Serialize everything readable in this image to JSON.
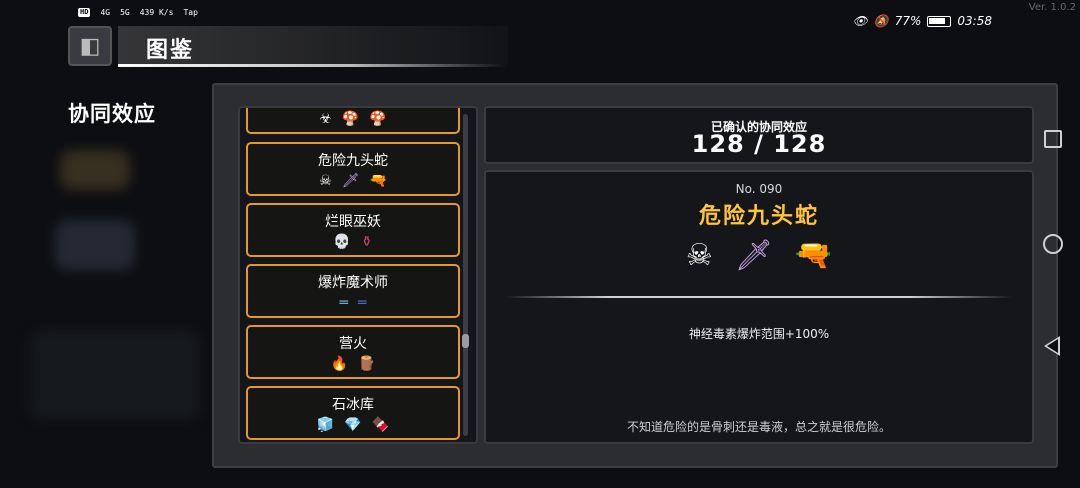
{
  "status_bar": {
    "left": [
      "HD",
      "4G",
      "5G",
      "439 K/s",
      "Tap"
    ],
    "eye_icon": "eye-icon",
    "bell_icon": "bell-muted-icon",
    "battery_percent": "77%",
    "time": "03:58"
  },
  "version": "Ver. 1.0.2",
  "header": {
    "title": "图鉴",
    "back_icon": "back-icon"
  },
  "section_title": "协同效应",
  "list": {
    "items": [
      {
        "label": "",
        "icons": [
          "☣",
          "🍄",
          "🍄"
        ],
        "colors": [
          "#ffffff",
          "#7fb6e8",
          "#d05040"
        ]
      },
      {
        "label": "危险九头蛇",
        "icons": [
          "☠",
          "🗡",
          "🔫"
        ],
        "colors": [
          "#ffffff",
          "#c8a0e0",
          "#c06040"
        ]
      },
      {
        "label": "烂眼巫妖",
        "icons": [
          "💀",
          "⚱"
        ],
        "colors": [
          "#e8e0c8",
          "#d04060"
        ]
      },
      {
        "label": "爆炸魔术师",
        "icons": [
          "═",
          "═"
        ],
        "colors": [
          "#6ab0c8",
          "#4070c0"
        ]
      },
      {
        "label": "营火",
        "icons": [
          "🔥",
          "🪵"
        ],
        "colors": [
          "#ff9030",
          "#b06030"
        ]
      },
      {
        "label": "石冰库",
        "icons": [
          "🧊",
          "💎",
          "🍫"
        ],
        "colors": [
          "#d8eef8",
          "#a0d0f0",
          "#b07040"
        ]
      }
    ]
  },
  "synergy_count": {
    "label": "已确认的协同效应",
    "value": "128 / 128"
  },
  "detail": {
    "number": "No. 090",
    "name": "危险九头蛇",
    "icons": [
      "☠",
      "🗡",
      "🔫"
    ],
    "icon_colors": [
      "#ffffff",
      "#c8a0e0",
      "#c06040"
    ],
    "effect": "神经毒素爆炸范围+100%",
    "description": "不知道危险的是骨刺还是毒液，总之就是很危险。"
  },
  "colors": {
    "accent_orange": "#e49a2a",
    "title_gold": "#ffc43a"
  }
}
